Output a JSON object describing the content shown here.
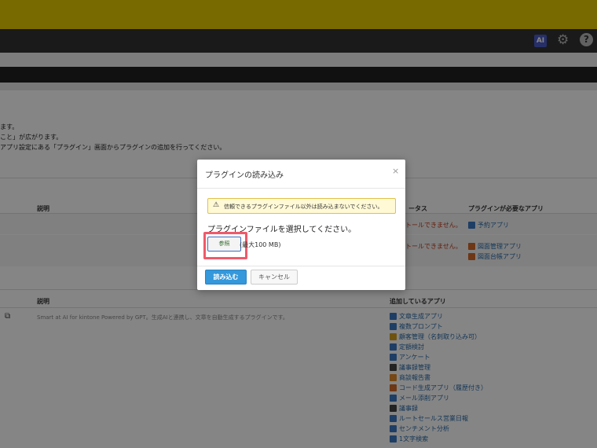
{
  "header": {
    "ai_label": "AI",
    "gear_icon": "gear-icon",
    "help_label": "?"
  },
  "page": {
    "intro_lines": [
      "ます。",
      "こと」が広がります。",
      "アプリ設定にある「プラグイン」画面からプラグインの追加を行ってください。"
    ],
    "table1": {
      "headers": {
        "desc": "説明",
        "status": "ータス",
        "apps": "プラグインが必要なアプリ"
      },
      "rows": [
        {
          "status": "トールできません。",
          "apps": [
            "予約アプリ"
          ]
        },
        {
          "status": "トールできません。",
          "apps": [
            "図面管理アプリ",
            "図面台帳アプリ"
          ]
        }
      ]
    },
    "table2": {
      "headers": {
        "desc": "説明",
        "apps": "追加しているアプリ"
      },
      "description": "Smart at AI for kintone Powered by GPT。生成AIと連携し、文章を自動生成するプラグインです。",
      "apps": [
        "文章生成アプリ",
        "複数プロンプト",
        "顧客管理（名刺取り込み可）",
        "定額検討",
        "アンケート",
        "議事録管理",
        "商談報告書",
        "コード生成アプリ（履歴付き）",
        "メール添削アプリ",
        "議事録",
        "ルートセールス営業日報",
        "センチメント分析",
        "1文字検索"
      ]
    }
  },
  "dialog": {
    "title": "プラグインの読み込み",
    "close_glyph": "×",
    "warning_text": "信頼できるプラグインファイル以外は読み込まないでください。",
    "warning_icon": "⚠",
    "select_label": "プラグインファイルを選択してください。",
    "browse_label": "参照",
    "size_limit": "(最大100 MB)",
    "load_label": "読み込む",
    "cancel_label": "キャンセル"
  },
  "colors": {
    "topbar": "#e8cc00",
    "accent_blue": "#3498db",
    "highlight": "#ef5a6a",
    "warning_bg": "#fff9d6"
  }
}
